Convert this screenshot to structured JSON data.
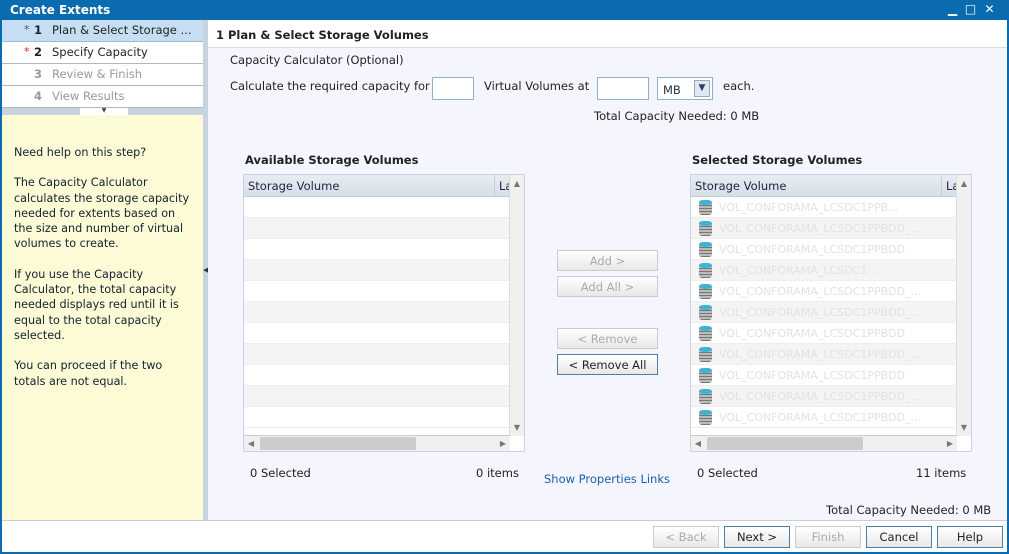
{
  "window": {
    "title": "Create Extents",
    "min": "▁",
    "max": "□",
    "close": "✕"
  },
  "steps": [
    {
      "num": "1",
      "label": "Plan & Select Storage ...",
      "state": "current"
    },
    {
      "num": "2",
      "label": "Specify Capacity",
      "state": "required"
    },
    {
      "num": "3",
      "label": "Review & Finish",
      "state": "disabled"
    },
    {
      "num": "4",
      "label": "View Results",
      "state": "disabled"
    }
  ],
  "help": {
    "p1": "Need help on this step?",
    "p2": "The Capacity Calculator calculates the storage capacity needed for extents based on the size and number of virtual volumes to create.",
    "p3": "If you use the Capacity Calculator, the total capacity needed displays red until it is equal to the total capacity selected.",
    "p4": "You can proceed if the two totals are not equal."
  },
  "main": {
    "title": "1  Plan & Select Storage Volumes",
    "calc_title": "Capacity Calculator (Optional)",
    "calc_prefix": "Calculate the required capacity for",
    "calc_mid": "Virtual Volumes at",
    "calc_suffix": "each.",
    "count_value": "",
    "size_value": "",
    "unit": "MB",
    "calc_total": "Total Capacity Needed: 0 MB",
    "available": {
      "title": "Available Storage Volumes",
      "col1": "Storage Volume",
      "col2": "La",
      "selected": "0 Selected",
      "items": "0 items"
    },
    "selected": {
      "title": "Selected Storage Volumes",
      "col1": "Storage Volume",
      "col2": "La",
      "selected": "0 Selected",
      "items": "11 items",
      "rows": [
        "VOL_CONFORAMA_LCSDC1PPB...",
        "VOL_CONFORAMA_LCSDC1PPBDD_...",
        "VOL_CONFORAMA_LCSDC1PPBDD",
        "VOL_CONFORAMA_LCSDC1...",
        "VOL_CONFORAMA_LCSDC1PPBDD_...",
        "VOL_CONFORAMA_LCSDC1PPBDD_...",
        "VOL_CONFORAMA_LCSDC1PPBDD",
        "VOL_CONFORAMA_LCSDC1PPBDD_...",
        "VOL_CONFORAMA_LCSDC1PPBDD",
        "VOL_CONFORAMA_LCSDC1PPBDD_...",
        "VOL_CONFORAMA_LCSDC1PPBDD_..."
      ]
    },
    "buttons": {
      "add": "Add >",
      "add_all": "Add All >",
      "remove": "< Remove",
      "remove_all": "< Remove All"
    },
    "show_props": "Show Properties Links",
    "total": "Total Capacity Needed: 0 MB"
  },
  "footer": {
    "back": "< Back",
    "next": "Next >",
    "finish": "Finish",
    "cancel": "Cancel",
    "help": "Help"
  },
  "colors": {
    "titlebar": "#0a6cae",
    "help_bg": "#fdfbd5",
    "link": "#1a5fb4",
    "required_star": "#e02020"
  }
}
